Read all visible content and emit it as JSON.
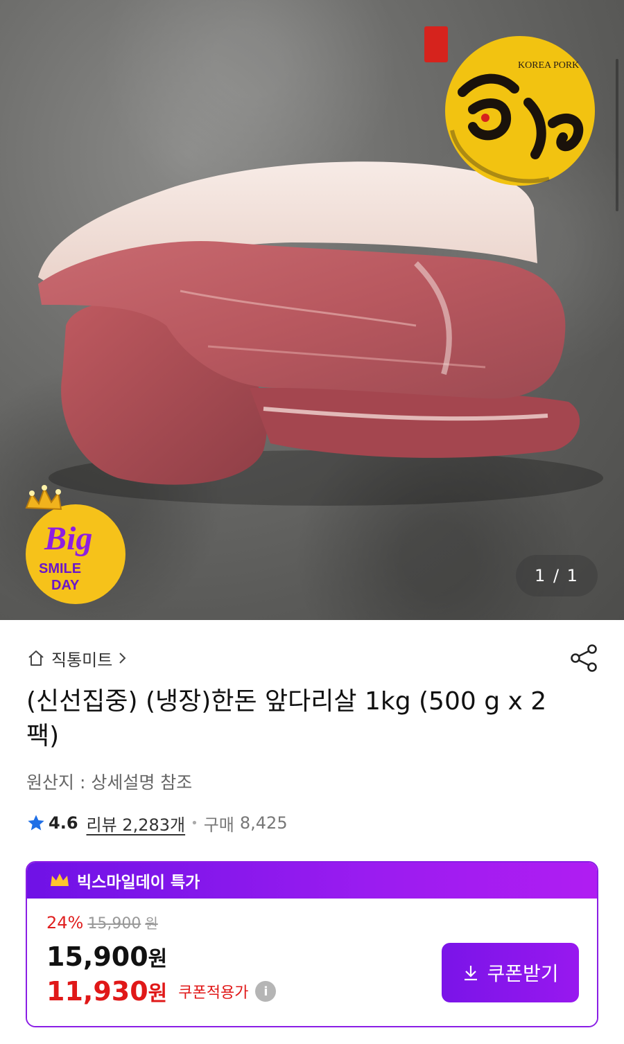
{
  "hero": {
    "logo": {
      "text_en": "KOREA PORK",
      "icon": "hantol-brand-logo"
    },
    "badge": {
      "big": "Big",
      "line1": "SMILE",
      "line2": "DAY",
      "icon": "crown-icon"
    },
    "pager": "1 / 1"
  },
  "seller": {
    "name": "직통미트",
    "icon": "home-icon",
    "chevron": "chevron-right-icon"
  },
  "share_icon": "share-icon",
  "product": {
    "title": "(신선집중) (냉장)한돈 앞다리살 1kg (500 g x 2팩)",
    "origin": "원산지 : 상세설명 참조",
    "rating": "4.6",
    "review_label": "리뷰 2,283개",
    "buy_label": "구매",
    "buy_count": "8,425"
  },
  "deal": {
    "header": "빅스마일데이 특가",
    "discount": "24%",
    "original_price": "15,900",
    "original_unit": "원",
    "price": "15,900",
    "price_unit": "원",
    "coupon_price": "11,930",
    "coupon_unit": "원",
    "coupon_label": "쿠폰적용가",
    "coupon_button": "쿠폰받기"
  },
  "colors": {
    "accent": "#8a1de5",
    "sale": "#e01818",
    "badge_yellow": "#f2c311"
  }
}
